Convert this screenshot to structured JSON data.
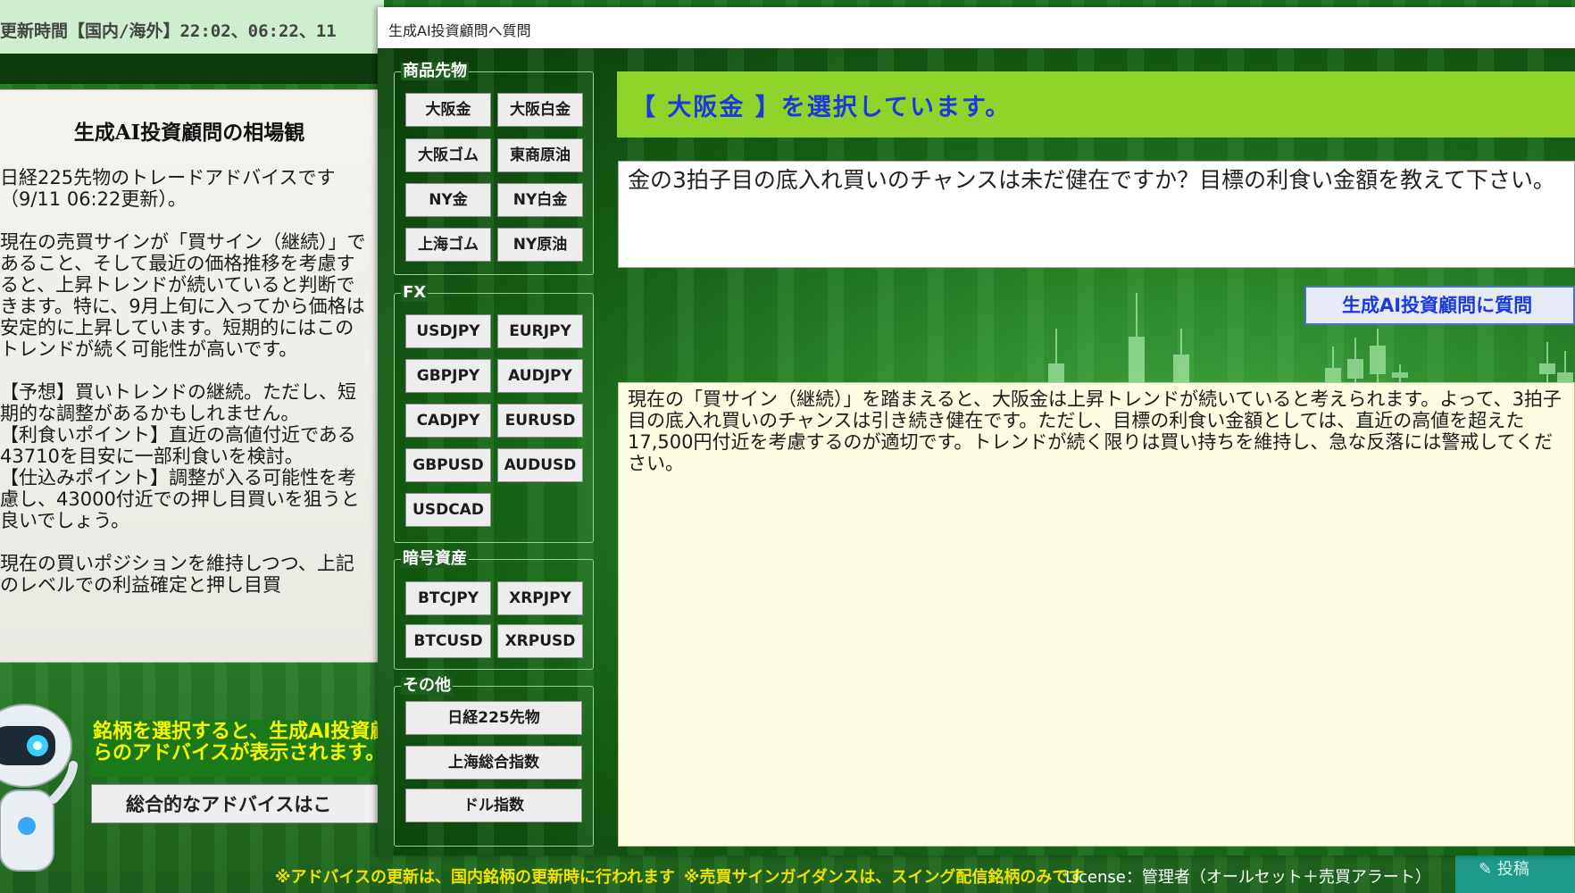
{
  "background": {
    "header_update_text": "更新時間【国内/海外】22:02、06:22、11",
    "panel_title": "生成AI投資顧問の相場観",
    "advice_text": "日経225先物のトレードアドバイスです（9/11 06:22更新）。\n\n現在の売買サインが「買サイン（継続）」であること、そして最近の価格推移を考慮すると、上昇トレンドが続いていると判断できます。特に、9月上旬に入ってから価格は安定的に上昇しています。短期的にはこのトレンドが続く可能性が高いです。\n\n【予想】買いトレンドの継続。ただし、短期的な調整があるかもしれません。\n【利食いポイント】直近の高値付近である43710を目安に一部利食いを検討。\n【仕込みポイント】調整が入る可能性を考慮し、43000付近での押し目買いを狙うと良いでしょう。\n\n現在の買いポジションを維持しつつ、上記のレベルでの利益確定と押し目買",
    "yellow_notice": "銘柄を選択すると、生成AI投資顧問か\nらのアドバイスが表示されます。",
    "overall_advice_button": "総合的なアドバイスはこ",
    "teal_button": "投稿"
  },
  "footer": {
    "note1": "※アドバイスの更新は、国内銘柄の更新時に行われます",
    "note2": "※売買サインガイダンスは、スイング配信銘柄のみです",
    "license": "License：管理者（オールセット＋売買アラート）"
  },
  "dialog": {
    "title": "生成AI投資顧問へ質問",
    "groups": {
      "commodity": {
        "label": "商品先物",
        "items": [
          "大阪金",
          "大阪白金",
          "大阪ゴム",
          "東商原油",
          "NY金",
          "NY白金",
          "上海ゴム",
          "NY原油"
        ]
      },
      "fx": {
        "label": "FX",
        "items": [
          "USDJPY",
          "EURJPY",
          "GBPJPY",
          "AUDJPY",
          "CADJPY",
          "EURUSD",
          "GBPUSD",
          "AUDUSD",
          "USDCAD"
        ]
      },
      "crypto": {
        "label": "暗号資産",
        "items": [
          "BTCJPY",
          "XRPJPY",
          "BTCUSD",
          "XRPUSD"
        ]
      },
      "other": {
        "label": "その他",
        "items": [
          "日経225先物",
          "上海総合指数",
          "ドル指数"
        ]
      }
    },
    "selected_text": "【 大阪金 】を選択しています。",
    "question_text": "金の3拍子目の底入れ買いのチャンスは未だ健在ですか？目標の利食い金額を教えて下さい。",
    "ask_button": "生成AI投資顧問に質問",
    "answer_text": "現在の「買サイン（継続）」を踏まえると、大阪金は上昇トレンドが続いていると考えられます。よって、3拍子目の底入れ買いのチャンスは引き続き健在です。ただし、目標の利食い金額としては、直近の高値を超えた17,500円付近を考慮するのが適切です。トレンドが続く限りは買い持ちを維持し、急な反落には警戒してください。"
  },
  "colors": {
    "selected_bar": "#8ed42a",
    "selected_text": "#1a3ae0",
    "notice_yellow": "#f7f500",
    "answer_bg": "#fdfde3"
  }
}
